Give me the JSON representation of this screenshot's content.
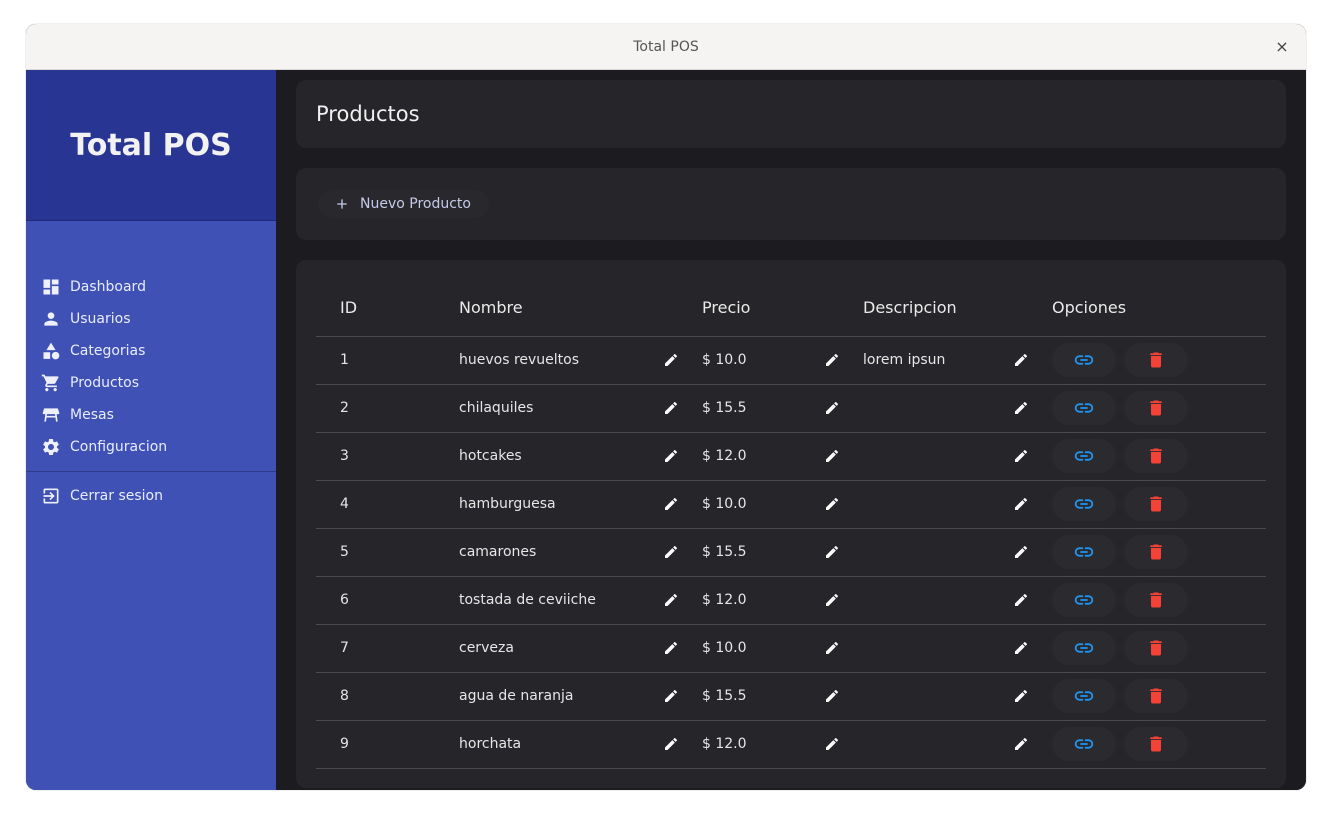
{
  "window": {
    "title": "Total POS",
    "close_glyph": "×"
  },
  "sidebar": {
    "brand": "Total POS",
    "items": [
      {
        "label": "Dashboard",
        "icon": "dashboard-icon"
      },
      {
        "label": "Usuarios",
        "icon": "user-icon"
      },
      {
        "label": "Categorias",
        "icon": "category-icon"
      },
      {
        "label": "Productos",
        "icon": "cart-icon"
      },
      {
        "label": "Mesas",
        "icon": "table-icon"
      },
      {
        "label": "Configuracion",
        "icon": "gear-icon"
      }
    ],
    "logout": {
      "label": "Cerrar sesion",
      "icon": "logout-icon"
    }
  },
  "page": {
    "title": "Productos"
  },
  "toolbar": {
    "new_label": "Nuevo Producto",
    "new_icon": "plus-icon"
  },
  "table": {
    "columns": [
      "ID",
      "Nombre",
      "Precio",
      "Descripcion",
      "Opciones"
    ],
    "rows": [
      {
        "id": "1",
        "nombre": "huevos revueltos",
        "precio": "$ 10.0",
        "descripcion": "lorem ipsun"
      },
      {
        "id": "2",
        "nombre": "chilaquiles",
        "precio": "$ 15.5",
        "descripcion": ""
      },
      {
        "id": "3",
        "nombre": "hotcakes",
        "precio": "$ 12.0",
        "descripcion": ""
      },
      {
        "id": "4",
        "nombre": "hamburguesa",
        "precio": "$ 10.0",
        "descripcion": ""
      },
      {
        "id": "5",
        "nombre": "camarones",
        "precio": "$ 15.5",
        "descripcion": ""
      },
      {
        "id": "6",
        "nombre": "tostada de ceviiche",
        "precio": "$ 12.0",
        "descripcion": ""
      },
      {
        "id": "7",
        "nombre": "cerveza",
        "precio": "$ 10.0",
        "descripcion": ""
      },
      {
        "id": "8",
        "nombre": "agua de naranja",
        "precio": "$ 15.5",
        "descripcion": ""
      },
      {
        "id": "9",
        "nombre": "horchata",
        "precio": "$ 12.0",
        "descripcion": ""
      }
    ]
  },
  "colors": {
    "sidebar": "#3f51b5",
    "brand": "#283593",
    "link": "#2196f3",
    "delete": "#f44336"
  }
}
